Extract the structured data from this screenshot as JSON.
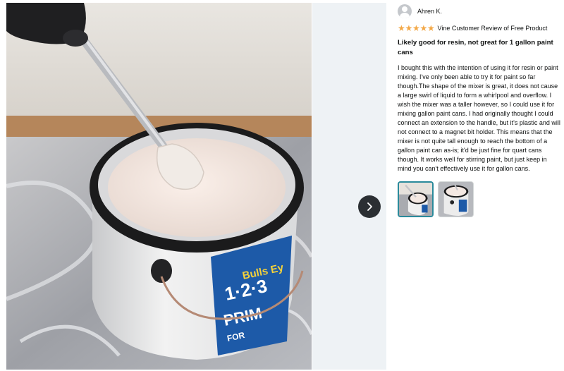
{
  "reviewer": {
    "name": "Ahren K."
  },
  "rating": {
    "stars": 5,
    "max": 5,
    "label": "Vine Customer Review of Free Product"
  },
  "review": {
    "title": "Likely good for resin, not great for 1 gallon paint cans",
    "body": "I bought this with the intention of using it for resin or paint mixing. I've only been able to try it for paint so far though.The shape of the mixer is great, it does not cause a large swirl of liquid to form a whirlpool and overflow. I wish the mixer was a taller however, so I could use it for mixing gallon paint cans. I had originally thought I could connect an extension to the handle, but it's plastic and will not connect to a magnet bit holder. This means that the mixer is not quite tall enough to reach the bottom of a gallon paint can as-is; it'd be just fine for quart cans though. It works well for stirring paint, but just keep in mind you can't effectively use it for gallon cans."
  },
  "photo": {
    "can_label_lines": [
      "Bulls Ey",
      "1·2·3",
      "PRIM",
      "FOR"
    ],
    "accent_color": "#1d5aa8"
  },
  "thumbnails": {
    "count": 2,
    "selected_index": 0
  },
  "icons": {
    "next": "chevron-right-icon",
    "avatar": "user-avatar-icon",
    "star": "star-icon"
  },
  "colors": {
    "star": "#f3a847",
    "selected_thumb_border": "#2a8a9b",
    "next_button": "#2b2f33"
  }
}
